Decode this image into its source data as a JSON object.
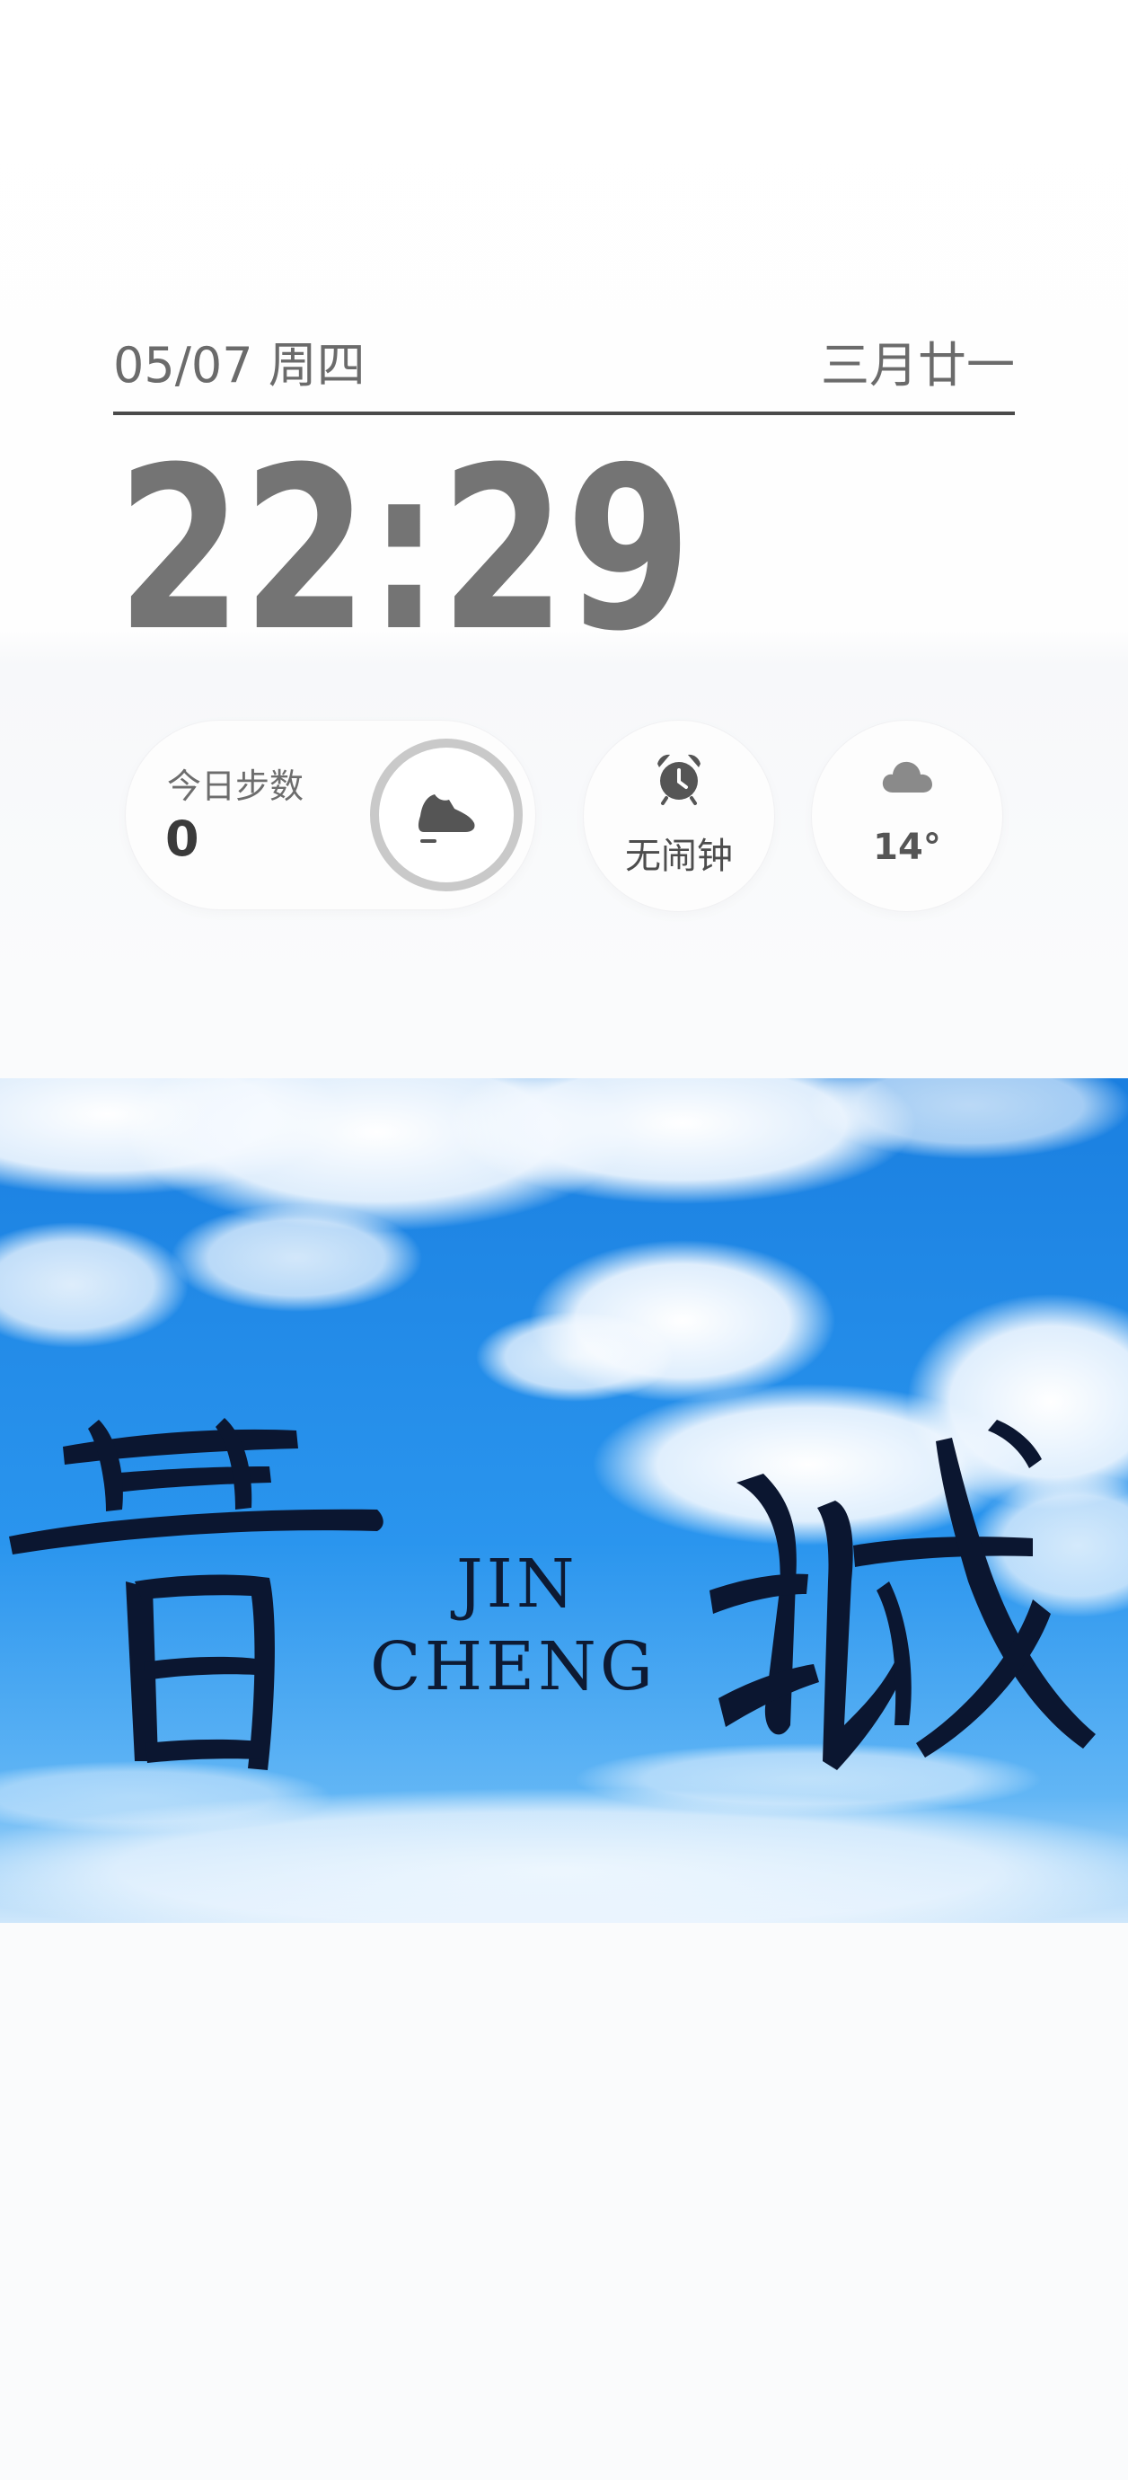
{
  "lockscreen": {
    "date": "05/07 周四",
    "lunar_date": "三月廿一",
    "time": "22:29"
  },
  "widgets": {
    "steps": {
      "label": "今日步数",
      "value": "0",
      "icon": "shoe-icon",
      "progress": 0
    },
    "alarm": {
      "label": "无闹钟",
      "icon": "alarm-clock-icon"
    },
    "weather": {
      "temperature": "14°",
      "icon": "cloud-icon"
    }
  },
  "wallpaper": {
    "calligraphy": "晋城",
    "english_line1": "JIN",
    "english_line2": "CHENG"
  },
  "colors": {
    "clock": "#747474",
    "sky": "#1f8fe8",
    "calligraphy_ink": "#0b1630"
  }
}
